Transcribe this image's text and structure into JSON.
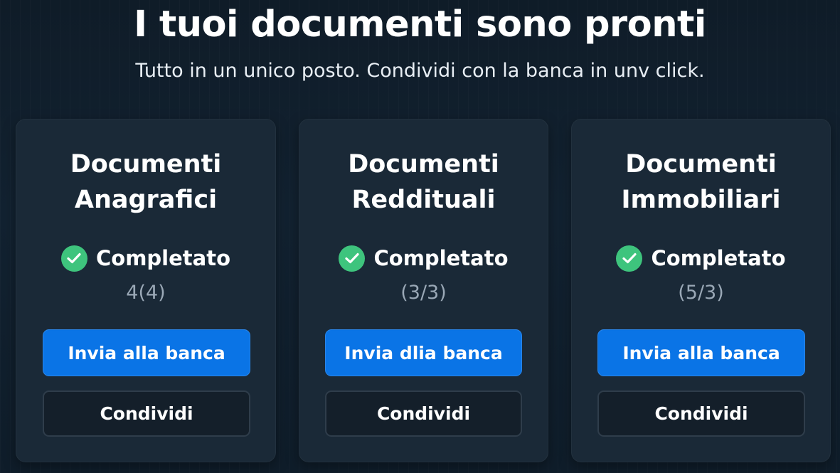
{
  "header": {
    "title": "I tuoi documenti sono pronti",
    "subtitle": "Tutto in un unico posto. Condividi con la banca in unv click."
  },
  "cards": [
    {
      "title_line1": "Documenti",
      "title_line2": "Anagrafici",
      "status": "Completato",
      "count": "4(4)",
      "primary_label": "Invia alla banca",
      "secondary_label": "Condividi"
    },
    {
      "title_line1": "Documenti",
      "title_line2": "Reddituali",
      "status": "Completato",
      "count": "(3/3)",
      "primary_label": "Invia dlia banca",
      "secondary_label": "Condividi"
    },
    {
      "title_line1": "Documenti",
      "title_line2": "Immobiliari",
      "status": "Completato",
      "count": "(5/3)",
      "primary_label": "Invia alla banca",
      "secondary_label": "Condividi"
    }
  ],
  "icons": {
    "status": "check-circle-icon"
  },
  "colors": {
    "background": "#112030",
    "card": "#1a2937",
    "primary": "#0a74e6",
    "success": "#3ec47d",
    "muted_text": "#9aa8b6"
  }
}
